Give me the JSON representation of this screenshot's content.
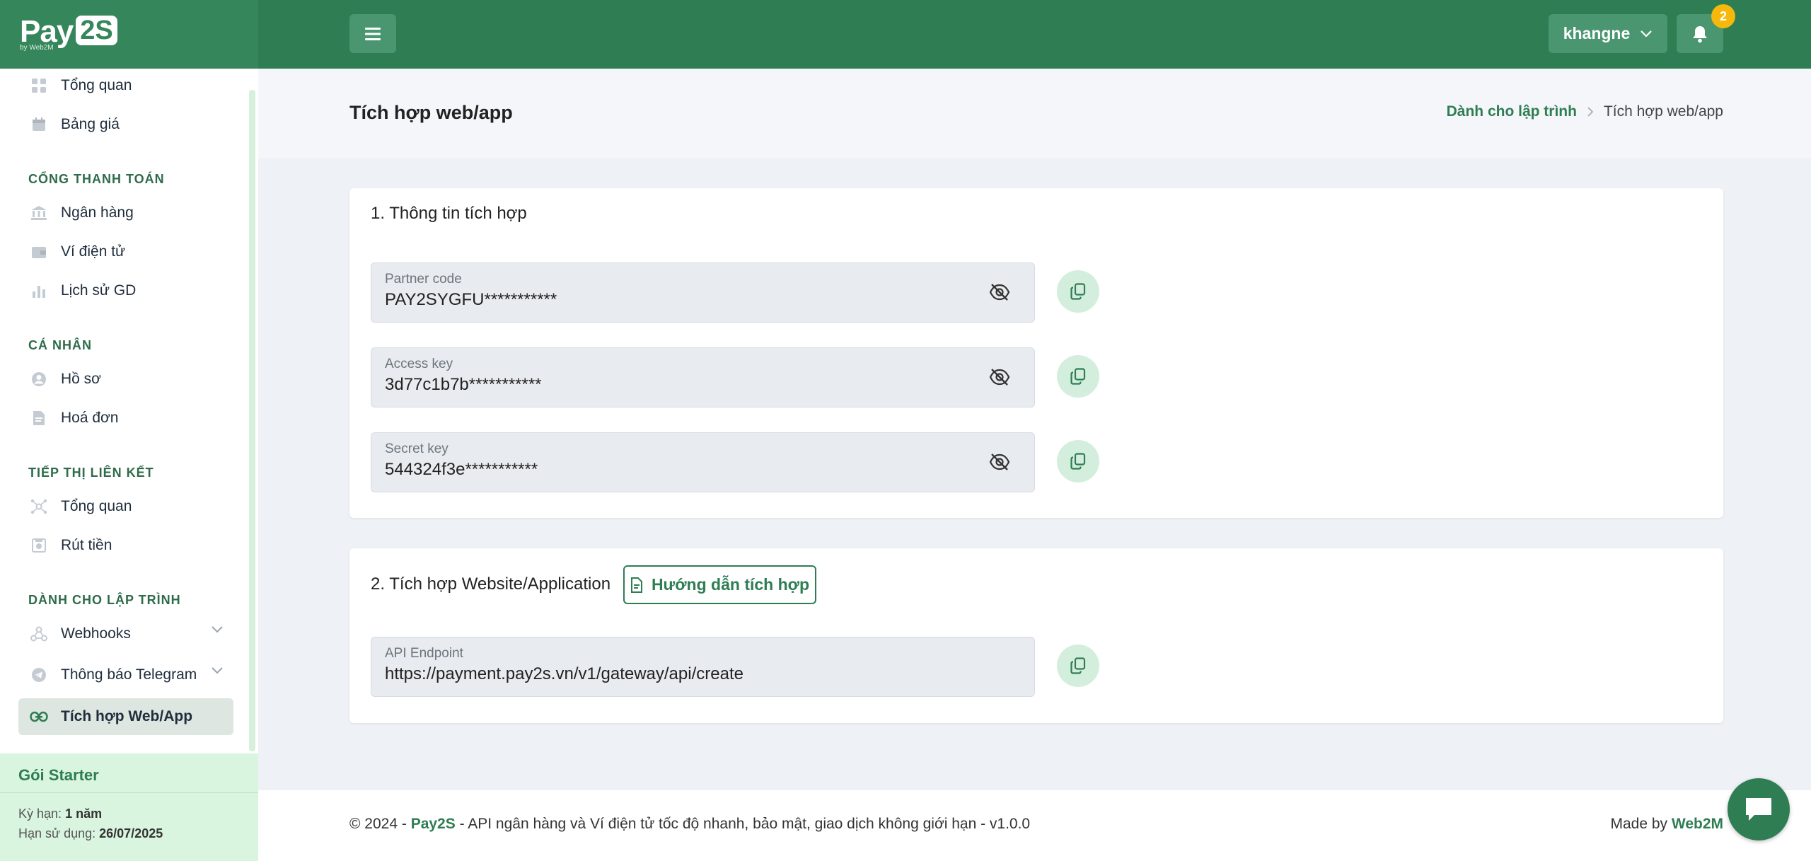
{
  "brand": {
    "logo_pay": "Pay",
    "logo_2s": "2S",
    "logo_sub": "by Web2M"
  },
  "header": {
    "username": "khangne",
    "notification_count": "2"
  },
  "sidebar": {
    "items_top": [
      {
        "label": "Tổng quan"
      },
      {
        "label": "Bảng giá"
      }
    ],
    "sections": [
      {
        "title": "CỔNG THANH TOÁN",
        "items": [
          {
            "label": "Ngân hàng"
          },
          {
            "label": "Ví điện tử"
          },
          {
            "label": "Lịch sử GD"
          }
        ]
      },
      {
        "title": "CÁ NHÂN",
        "items": [
          {
            "label": "Hồ sơ"
          },
          {
            "label": "Hoá đơn"
          }
        ]
      },
      {
        "title": "TIẾP THỊ LIÊN KẾT",
        "items": [
          {
            "label": "Tổng quan"
          },
          {
            "label": "Rút tiền"
          }
        ]
      },
      {
        "title": "DÀNH CHO LẬP TRÌNH",
        "items": [
          {
            "label": "Webhooks"
          },
          {
            "label": "Thông báo Telegram"
          },
          {
            "label": "Tích hợp Web/App"
          }
        ]
      }
    ],
    "plan": {
      "title": "Gói Starter",
      "term_label": "Kỳ hạn:",
      "term_value": "1 năm",
      "expiry_label": "Hạn sử dụng:",
      "expiry_value": "26/07/2025"
    }
  },
  "page": {
    "title": "Tích hợp web/app",
    "breadcrumb": {
      "parent": "Dành cho lập trình",
      "current": "Tích hợp web/app"
    }
  },
  "integration_info": {
    "title": "1. Thông tin tích hợp",
    "fields": [
      {
        "label": "Partner code",
        "value": "PAY2SYGFU***********"
      },
      {
        "label": "Access key",
        "value": "3d77c1b7b***********"
      },
      {
        "label": "Secret key",
        "value": "544324f3e***********"
      }
    ]
  },
  "website_integration": {
    "title": "2. Tích hợp Website/Application",
    "guide_button": "Hướng dẫn tích hợp",
    "endpoint": {
      "label": "API Endpoint",
      "value": "https://payment.pay2s.vn/v1/gateway/api/create"
    }
  },
  "footer": {
    "prefix": "© 2024 - ",
    "brand": "Pay2S",
    "text": " - API ngân hàng và Ví điện tử tốc độ nhanh, bảo mật, giao dịch không giới hạn - v1.0.0",
    "made_by": "Made by ",
    "made_by_brand": "Web2M"
  },
  "colors": {
    "primary": "#2e7d53",
    "sidebar_brand": "#35865a",
    "badge": "#f5b80b",
    "plan_bg": "#d9f5df"
  }
}
